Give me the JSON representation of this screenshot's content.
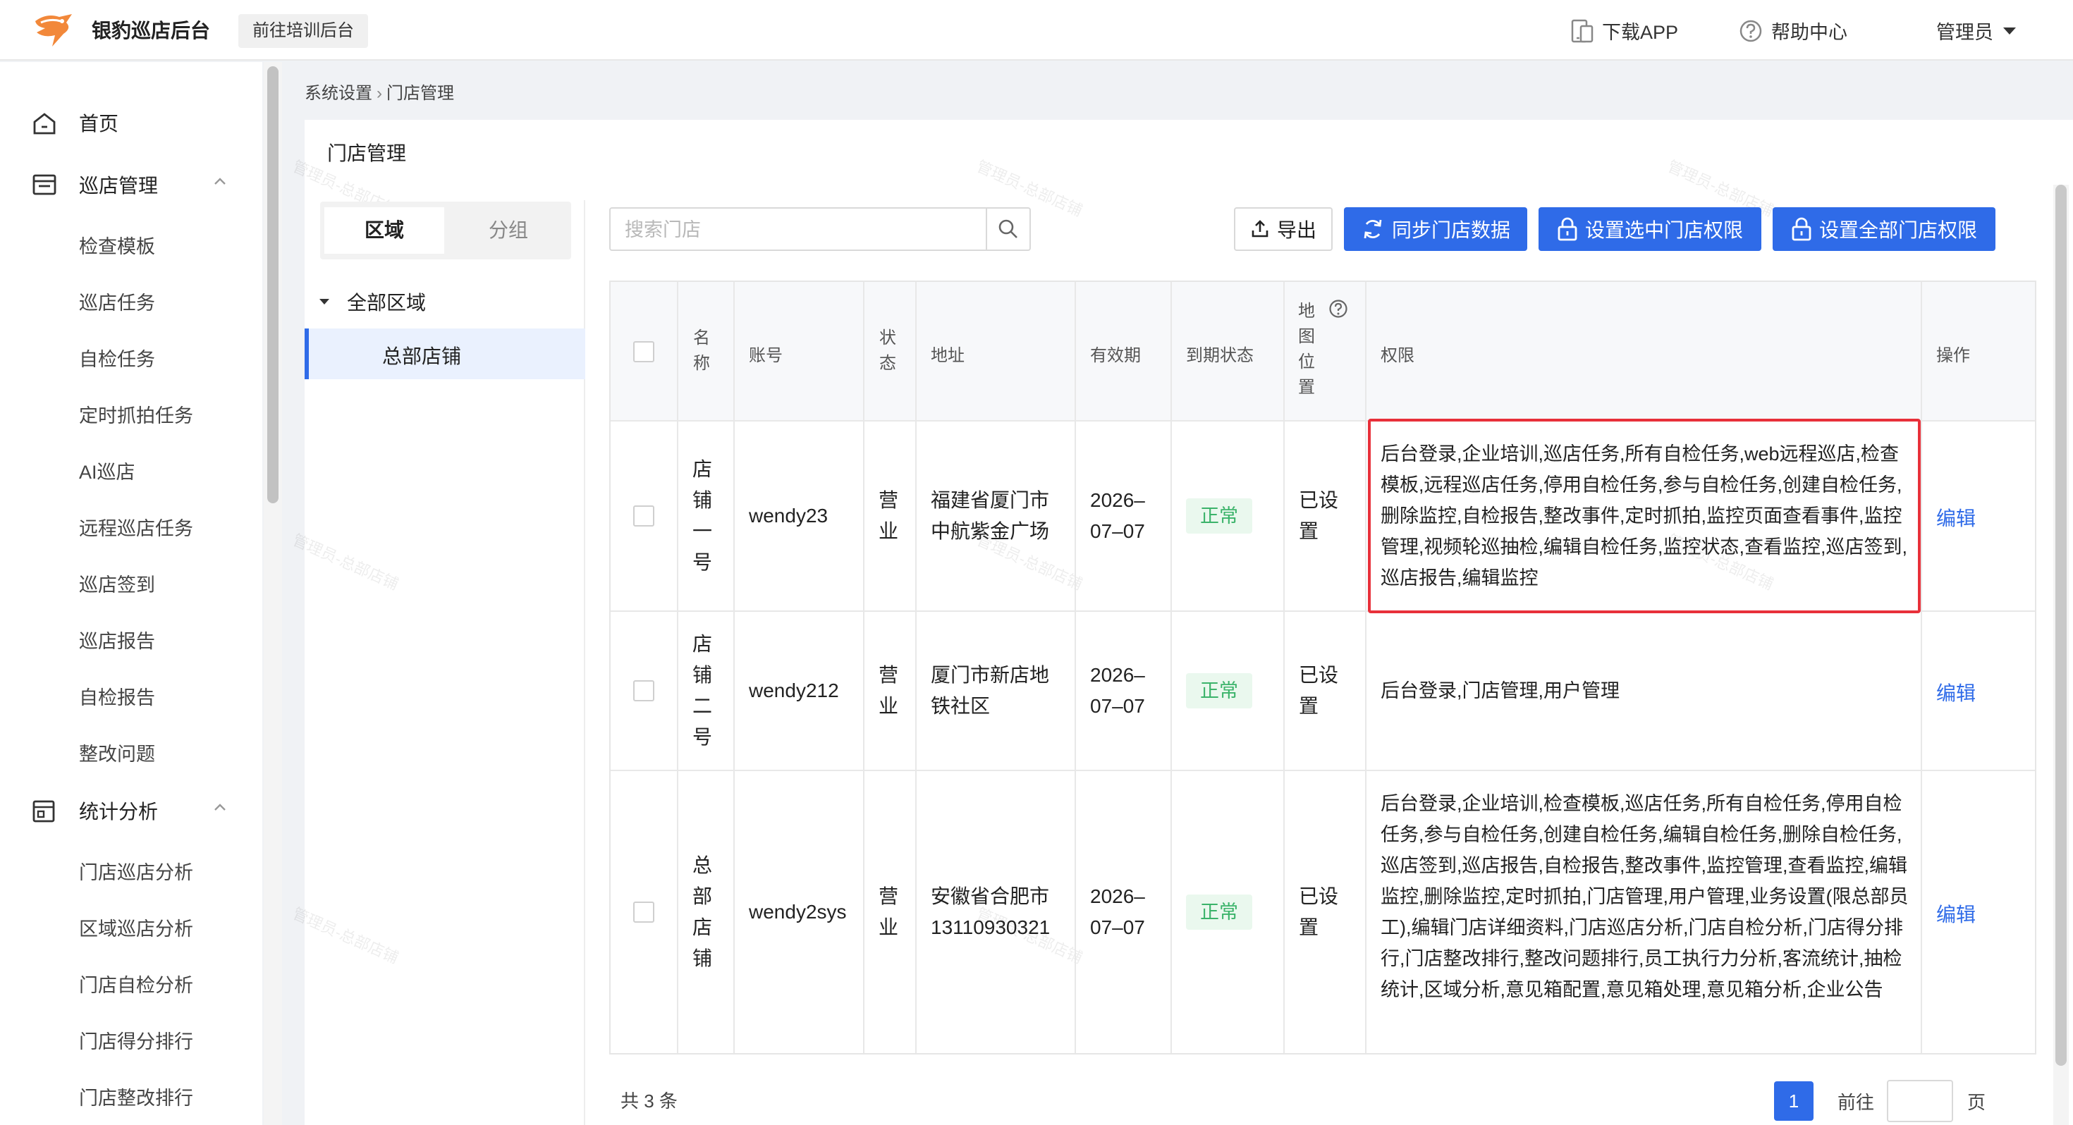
{
  "header": {
    "app_title": "银豹巡店后台",
    "train_button": "前往培训后台",
    "download_app": "下载APP",
    "help_center": "帮助中心",
    "user": "管理员"
  },
  "sidebar": {
    "home": "首页",
    "patrol_group": "巡店管理",
    "patrol_items": [
      "检查模板",
      "巡店任务",
      "自检任务",
      "定时抓拍任务",
      "AI巡店",
      "远程巡店任务",
      "巡店签到",
      "巡店报告",
      "自检报告",
      "整改问题"
    ],
    "stats_group": "统计分析",
    "stats_items": [
      "门店巡店分析",
      "区域巡店分析",
      "门店自检分析",
      "门店得分排行",
      "门店整改排行"
    ]
  },
  "breadcrumb": {
    "parent": "系统设置",
    "separator": "›",
    "current": "门店管理"
  },
  "page_title": "门店管理",
  "tree": {
    "tab_region": "区域",
    "tab_group": "分组",
    "root": "全部区域",
    "leaf": "总部店铺"
  },
  "toolbar": {
    "search_placeholder": "搜索门店",
    "export": "导出",
    "sync": "同步门店数据",
    "set_selected": "设置选中门店权限",
    "set_all": "设置全部门店权限"
  },
  "table": {
    "headers": {
      "name": [
        "名",
        "称"
      ],
      "account": "账号",
      "status": [
        "状",
        "态"
      ],
      "address": "地址",
      "validity": "有效期",
      "expiry_status": "到期状态",
      "map_position": [
        "地",
        "图",
        "位",
        "置"
      ],
      "permissions": "权限",
      "actions": "操作"
    },
    "rows": [
      {
        "name": [
          "店",
          "铺",
          "一",
          "号"
        ],
        "account": "wendy23",
        "status": [
          "营",
          "业"
        ],
        "address": [
          "福建省厦门市",
          "中航紫金广场"
        ],
        "validity": [
          "2026–",
          "07–07"
        ],
        "expiry_status": "正常",
        "map_position": [
          "已设",
          "置"
        ],
        "permissions": "后台登录,企业培训,巡店任务,所有自检任务,web远程巡店,检查模板,远程巡店任务,停用自检任务,参与自检任务,创建自检任务,删除监控,自检报告,整改事件,定时抓拍,监控页面查看事件,监控管理,视频轮巡抽检,编辑自检任务,监控状态,查看监控,巡店签到,巡店报告,编辑监控",
        "action": "编辑"
      },
      {
        "name": [
          "店",
          "铺",
          "二",
          "号"
        ],
        "account": "wendy212",
        "status": [
          "营",
          "业"
        ],
        "address": [
          "厦门市新店地",
          "铁社区"
        ],
        "validity": [
          "2026–",
          "07–07"
        ],
        "expiry_status": "正常",
        "map_position": [
          "已设",
          "置"
        ],
        "permissions": "后台登录,门店管理,用户管理",
        "action": "编辑"
      },
      {
        "name": [
          "总",
          "部",
          "店",
          "铺"
        ],
        "account": "wendy2sys",
        "status": [
          "营",
          "业"
        ],
        "address": [
          "安徽省合肥市",
          "13110930321"
        ],
        "validity": [
          "2026–",
          "07–07"
        ],
        "expiry_status": "正常",
        "map_position": [
          "已设",
          "置"
        ],
        "permissions": "后台登录,企业培训,检查模板,巡店任务,所有自检任务,停用自检任务,参与自检任务,创建自检任务,编辑自检任务,删除自检任务,巡店签到,巡店报告,自检报告,整改事件,监控管理,查看监控,编辑监控,删除监控,定时抓拍,门店管理,用户管理,业务设置(限总部员工),编辑门店详细资料,门店巡店分析,门店自检分析,门店得分排行,门店整改排行,整改问题排行,员工执行力分析,客流统计,抽检统计,区域分析,意见箱配置,意见箱处理,意见箱分析,企业公告",
        "action": "编辑"
      }
    ]
  },
  "footer": {
    "total": "共 3 条",
    "current_page": "1",
    "goto_prefix": "前往",
    "goto_suffix": "页"
  },
  "watermark": "管理员-总部店铺",
  "colors": {
    "primary": "#2f6be8",
    "success": "#3bb36a",
    "highlight": "#e8303a"
  }
}
